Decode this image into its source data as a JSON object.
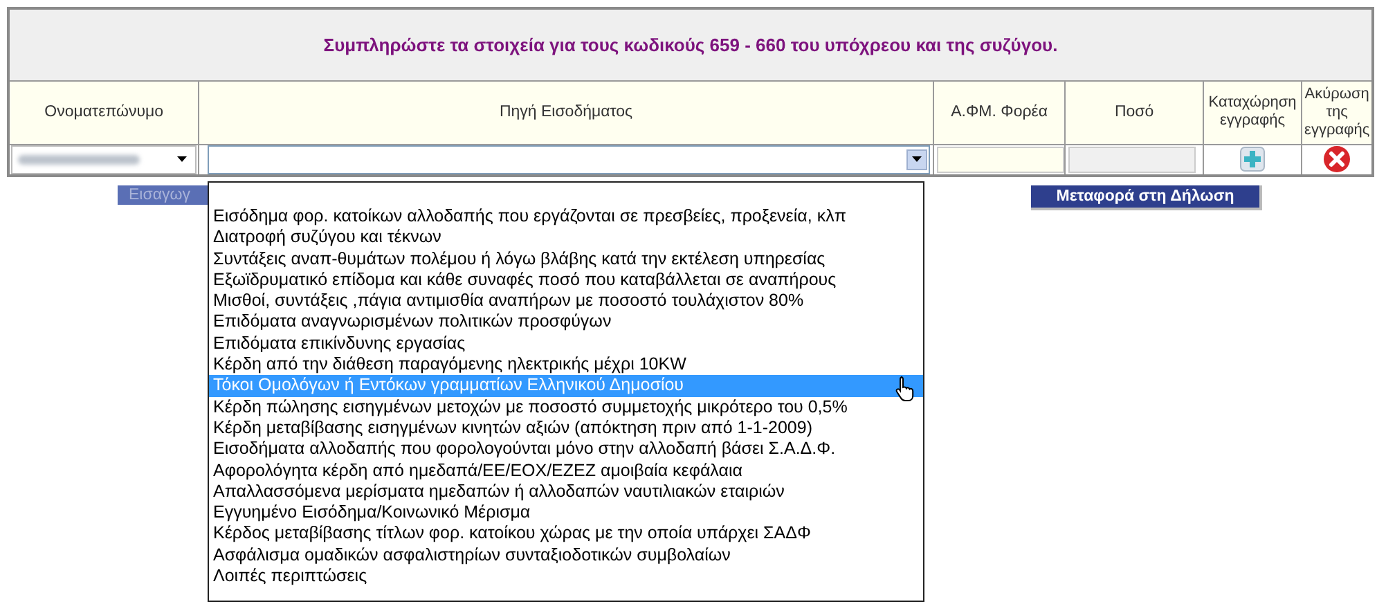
{
  "heading": "Συμπληρώστε τα στοιχεία για τους κωδικούς 659 - 660 του υπόχρεου και της συζύγου.",
  "columns": [
    "Ονοματεπώνυμο",
    "Πηγή Εισοδήματος",
    "Α.ΦΜ. Φορέα",
    "Ποσό",
    "Καταχώρηση εγγραφής",
    "Ακύρωση της εγγραφής"
  ],
  "source_dropdown": {
    "expanded": true,
    "options": [
      {
        "label": "Εισόδημα φορ. κατοίκων αλλοδαπής που εργάζονται σε πρεσβείες, προξενεία, κλπ",
        "selected": false
      },
      {
        "label": "Διατροφή συζύγου και τέκνων",
        "selected": false
      },
      {
        "label": "Συντάξεις αναπ-θυμάτων πολέμου ή λόγω βλάβης κατά την εκτέλεση υπηρεσίας",
        "selected": false
      },
      {
        "label": "Εξωϊδρυματικό επίδομα και κάθε συναφές ποσό που καταβάλλεται σε αναπήρους",
        "selected": false
      },
      {
        "label": "Μισθοί, συντάξεις ,πάγια αντιμισθία αναπήρων με ποσοστό τουλάχιστον 80%",
        "selected": false
      },
      {
        "label": "Επιδόματα αναγνωρισμένων πολιτικών προσφύγων",
        "selected": false
      },
      {
        "label": "Επιδόματα επικίνδυνης εργασίας",
        "selected": false
      },
      {
        "label": "Κέρδη από την διάθεση παραγόμενης ηλεκτρικής μέχρι 10KW",
        "selected": false
      },
      {
        "label": "Τόκοι Ομολόγων ή Εντόκων γραμματίων Ελληνικού Δημοσίου",
        "selected": true
      },
      {
        "label": "Κέρδη πώλησης εισηγμένων μετοχών με ποσοστό συμμετοχής μικρότερο του 0,5%",
        "selected": false
      },
      {
        "label": "Κέρδη μεταβίβασης εισηγμένων κινητών αξιών (απόκτηση πριν από 1-1-2009)",
        "selected": false
      },
      {
        "label": "Εισοδήματα αλλοδαπής που φορολογούνται μόνο στην αλλοδαπή βάσει Σ.Α.Δ.Φ.",
        "selected": false
      },
      {
        "label": "Αφορολόγητα κέρδη από ημεδαπά/ΕΕ/ΕΟΧ/ΕΖΕΖ αμοιβαία κεφάλαια",
        "selected": false
      },
      {
        "label": "Απαλλασσόμενα μερίσματα ημεδαπών ή αλλοδαπών ναυτιλιακών εταιριών",
        "selected": false
      },
      {
        "label": "Εγγυημένο Εισόδημα/Κοινωνικό Μέρισμα",
        "selected": false
      },
      {
        "label": "Κέρδος μεταβίβασης τίτλων φορ. κατοίκου χώρας με την οποία υπάρχει ΣΑΔΦ",
        "selected": false
      },
      {
        "label": "Ασφάλισμα ομαδικών ασφαλιστηρίων συνταξιοδοτικών συμβολαίων",
        "selected": false
      },
      {
        "label": "Λοιπές περιπτώσεις",
        "selected": false
      }
    ]
  },
  "buttons": {
    "insert": "Εισαγωγ",
    "transfer": "Μεταφορά στη Δήλωση"
  }
}
